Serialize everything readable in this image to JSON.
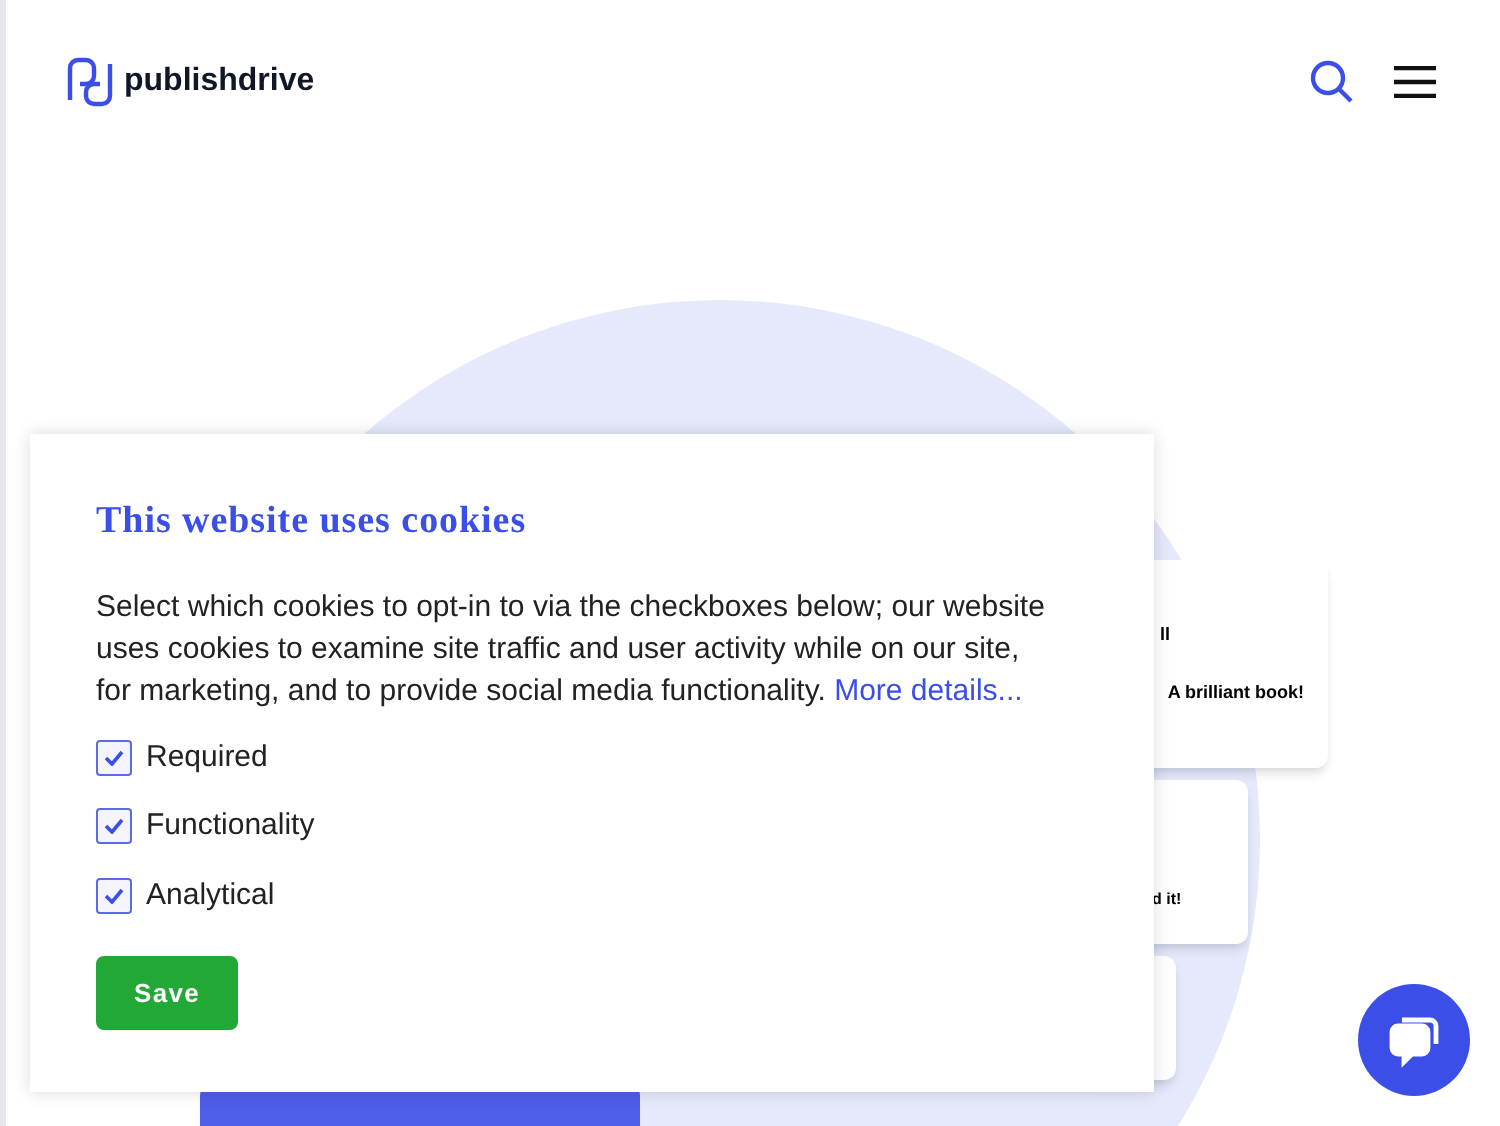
{
  "header": {
    "logo_text": "publishdrive"
  },
  "background_cards": [
    {
      "text": "ll"
    },
    {
      "text": "A brilliant book!"
    },
    {
      "text": "d it!"
    }
  ],
  "cookie_dialog": {
    "title": "This website uses cookies",
    "body": "Select which cookies to opt-in to via the checkboxes below; our website uses cookies to examine site traffic and user activity while on our site, for marketing, and to provide social media functionality.",
    "link": "More details...",
    "options": [
      {
        "label": "Required",
        "checked": true
      },
      {
        "label": "Functionality",
        "checked": true
      },
      {
        "label": "Analytical",
        "checked": true
      }
    ],
    "button": "Save"
  }
}
